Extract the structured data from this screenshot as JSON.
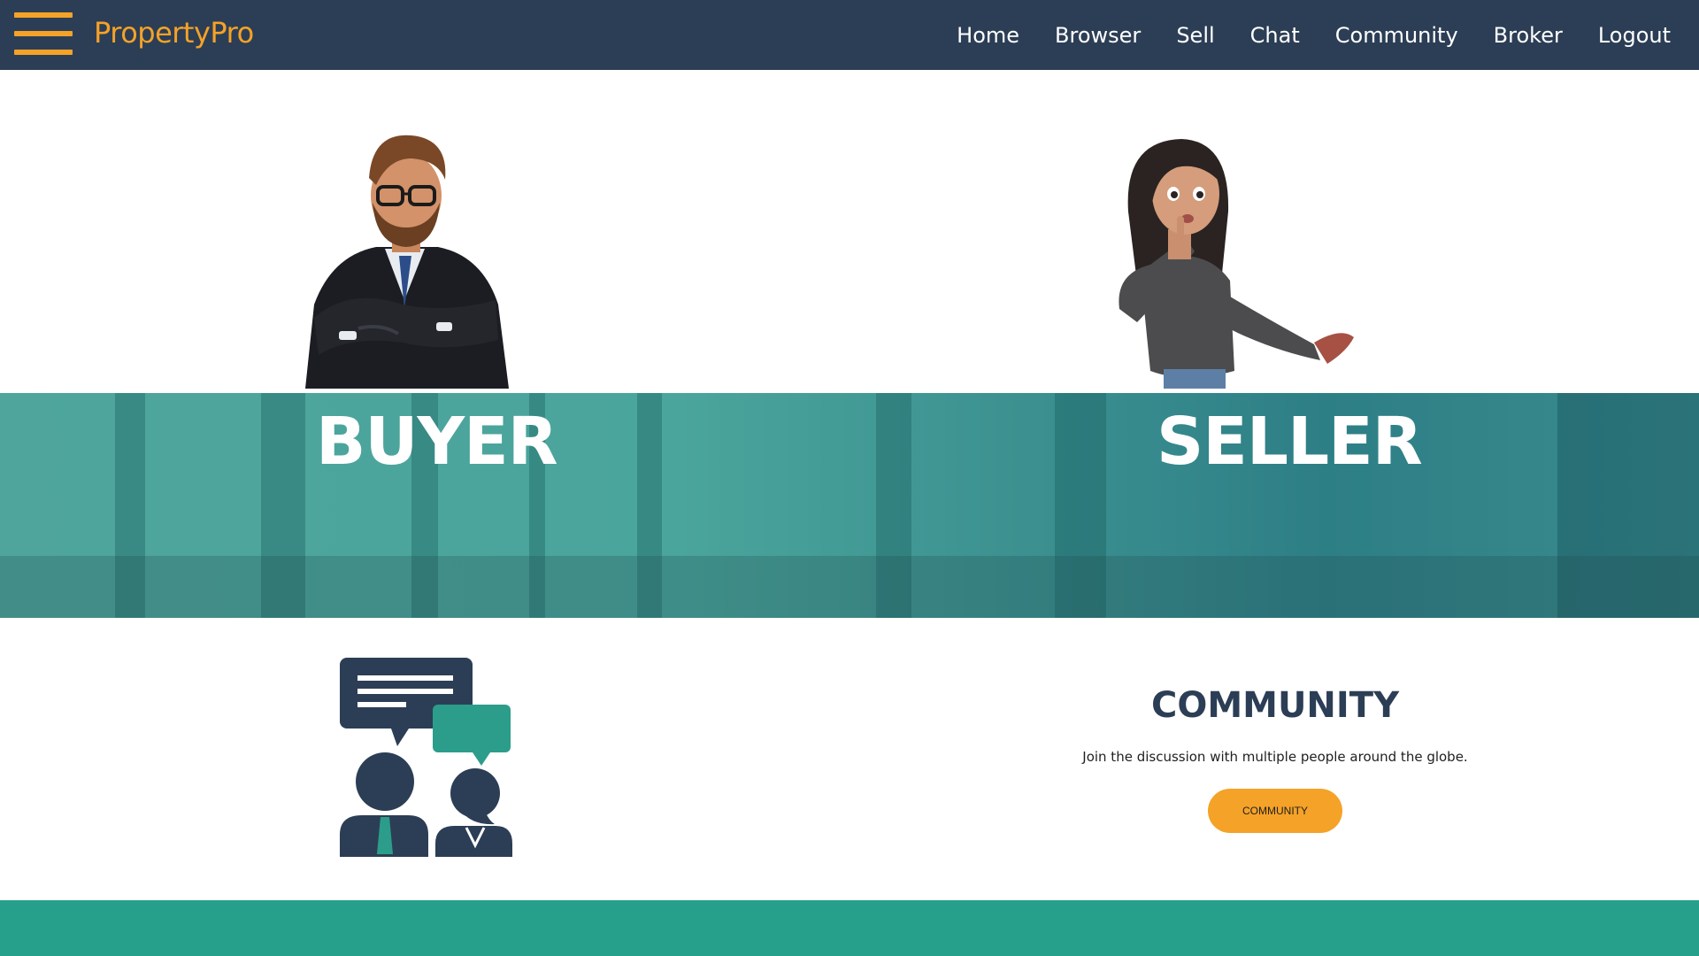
{
  "brand": {
    "name": "PropertyPro"
  },
  "nav": {
    "items": [
      {
        "label": "Home"
      },
      {
        "label": "Browser"
      },
      {
        "label": "Sell"
      },
      {
        "label": "Chat"
      },
      {
        "label": "Community"
      },
      {
        "label": "Broker"
      },
      {
        "label": "Logout"
      }
    ]
  },
  "hero": {
    "buyer_label": "BUYER",
    "seller_label": "SELLER"
  },
  "community": {
    "title": "COMMUNITY",
    "description": "Join the discussion with multiple people around the globe.",
    "button_label": "COMMUNITY"
  },
  "colors": {
    "navbar": "#2c3e55",
    "accent": "#f5a228",
    "band_teal": "#4aa59c",
    "footer_teal": "#27a08b",
    "dark_text": "#2c3e55"
  },
  "icons": [
    "menu-icon",
    "buyer-avatar-icon",
    "seller-avatar-icon",
    "community-chat-icon"
  ]
}
